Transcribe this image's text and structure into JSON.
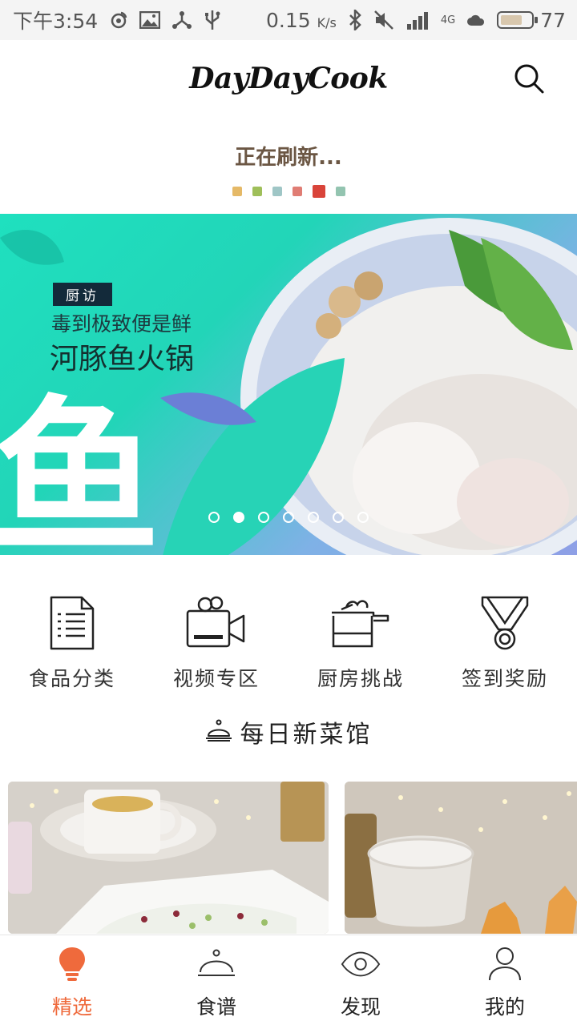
{
  "status_bar": {
    "time": "下午3:54",
    "speed": "0.15",
    "speed_unit": "K/s",
    "network": "4G",
    "battery_level": "77",
    "battery_fraction": 0.77,
    "icons": [
      "weibo-icon",
      "image-icon",
      "share-icon",
      "usb-icon",
      "bluetooth-icon",
      "mute-icon",
      "signal-icon",
      "cloud-icon",
      "battery-icon"
    ]
  },
  "header": {
    "logo": "DayDayCook",
    "search_icon": "search-icon"
  },
  "refresh": {
    "text": "正在刷新...",
    "dot_colors": [
      "#e5b967",
      "#9fbf5a",
      "#9fc6c6",
      "#e07d74",
      "#d9443a",
      "#93c4b0"
    ]
  },
  "banner": {
    "tag": "厨访",
    "subtitle": "毒到极致便是鲜",
    "title": "河豚鱼火锅",
    "big_char": "鱼",
    "page_count": 7,
    "active_page": 2
  },
  "categories": [
    {
      "label": "食品分类",
      "icon": "document-list-icon"
    },
    {
      "label": "视频专区",
      "icon": "video-camera-icon"
    },
    {
      "label": "厨房挑战",
      "icon": "cooking-pot-icon"
    },
    {
      "label": "签到奖励",
      "icon": "medal-icon"
    }
  ],
  "section": {
    "title": "每日新菜馆",
    "icon": "service-bell-icon"
  },
  "bottom_nav": {
    "active_color": "#ef6a3c",
    "items": [
      {
        "label": "精选",
        "icon": "lightbulb-icon",
        "active": true
      },
      {
        "label": "食谱",
        "icon": "cloche-icon",
        "active": false
      },
      {
        "label": "发现",
        "icon": "eye-icon",
        "active": false
      },
      {
        "label": "我的",
        "icon": "user-icon",
        "active": false
      }
    ]
  }
}
